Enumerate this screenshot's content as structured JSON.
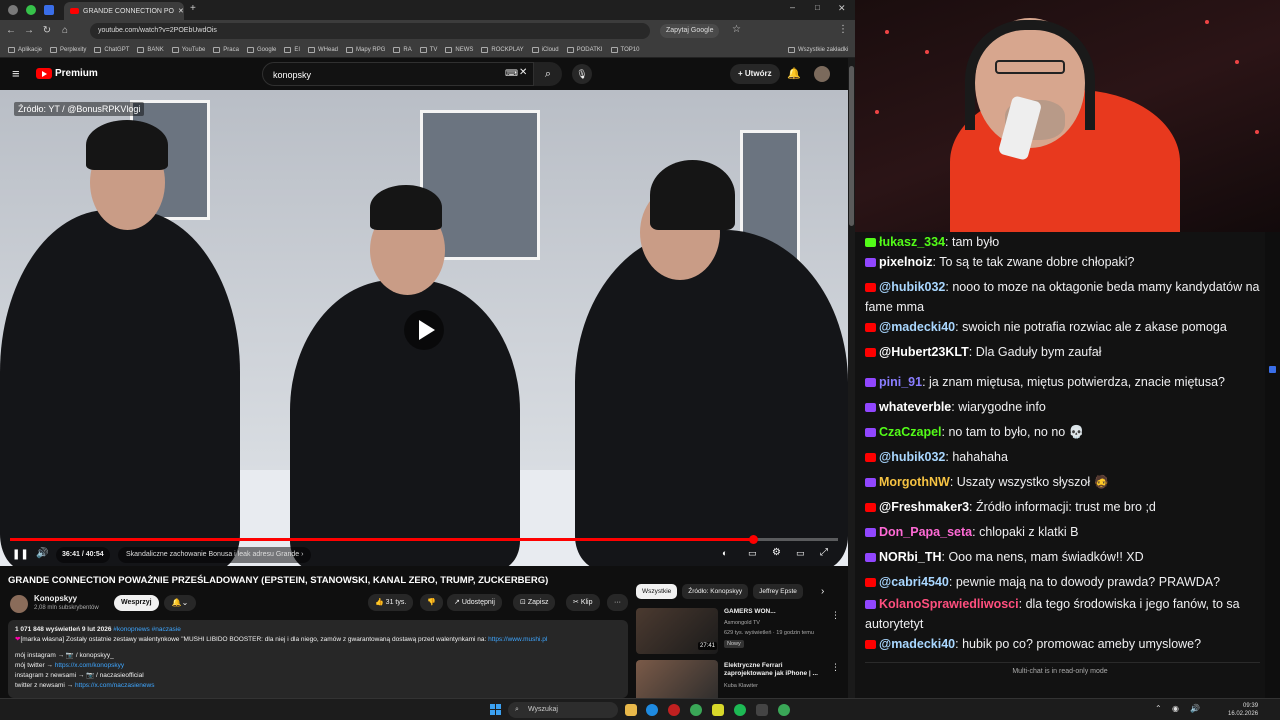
{
  "browser": {
    "tab_title": "GRANDE CONNECTION PO",
    "url": "youtube.com/watch?v=2POEbUwdOis",
    "ask_google": "Zapytaj Google",
    "bookmarks": [
      "Aplikacje",
      "Perplexity",
      "ChatGPT",
      "BANK",
      "YouTube",
      "Praca",
      "Google",
      "EI",
      "WHead",
      "Mapy RPG",
      "RA",
      "TV",
      "NEWS",
      "ROCKPLAY",
      "iCloud",
      "PODATKI",
      "TOP10"
    ],
    "all_bookmarks": "Wszystkie zakładki"
  },
  "yt": {
    "logo": "Premium",
    "search_value": "konopsky",
    "create": "Utwórz"
  },
  "video": {
    "source_overlay": "Źródło: YT / @BonusRPKVlogi",
    "time": "36:41 / 40:54",
    "chapter": "Skandaliczne zachowanie Bonusa i leak adresu Grande",
    "progress": 0.897,
    "title": "GRANDE CONNECTION POWAŻNIE PRZEŚLADOWANY (EPSTEIN, STANOWSKI, KANAL ZERO, TRUMP, ZUCKERBERG)",
    "channel": "Konopskyy",
    "subs": "2,08 mln subskrybentów",
    "support": "Wesprzyj",
    "likes": "31 tys.",
    "share": "Udostępnij",
    "save": "Zapisz",
    "clip": "Klip",
    "more": "···",
    "desc_stats": "1 071 848 wyświetleń  9 lut 2026",
    "desc_tags": "#konopnews #naczasie",
    "desc_line1": "[marka własna] Zostały ostatnie zestawy walentynkowe \"MUSHI LIBIDO BOOSTER: dla niej i dla niego, zamów z gwarantowaną dostawą przed walentynkami na: ",
    "desc_link1": "https://www.mushi.pl",
    "desc_line2": "mój instagram → 📷 / konopskyy_",
    "desc_line3a": "mój twitter → ",
    "desc_link3": "https://x.com/konopskyy",
    "desc_line4": "instagram z newsami → 📷 / naczasieofficial",
    "desc_line5a": "twitter z newsami → ",
    "desc_link5": "https://x.com/naczasienews"
  },
  "recs": {
    "chips": [
      "Wszystkie",
      "Źródło: Konopskyy",
      "Jeffrey Epste"
    ],
    "items": [
      {
        "title": "GAMERS WON...",
        "channel": "Asmongold TV",
        "meta": "629 tys. wyświetleń · 19 godzin temu",
        "badge": "Nowy",
        "duration": "27:41"
      },
      {
        "title": "Elektryczne Ferrari zaprojektowane jak iPhone | ...",
        "channel": "Kuba Klawiter",
        "meta": "",
        "badge": "",
        "duration": ""
      }
    ]
  },
  "chat": {
    "messages": [
      {
        "platform": "tk",
        "user": "łukasz_334",
        "color": "#53fc18",
        "text": "tam było"
      },
      {
        "platform": "tw",
        "user": "pixelnoiz",
        "color": "#ffffff",
        "text": "To są te tak zwane dobre chłopaki?"
      },
      {
        "platform": "yt",
        "user": "@hubik032",
        "color": "#a9d7ff",
        "text": "nooo to moze na oktagonie beda mamy kandydatów na fame mma"
      },
      {
        "platform": "yt",
        "user": "@madecki40",
        "color": "#a9d7ff",
        "text": "swoich nie potrafia rozwiac ale z akase pomoga"
      },
      {
        "platform": "yt",
        "user": "@Hubert23KLT",
        "color": "#ffffff",
        "text": "Dla Gaduły bym zaufał"
      },
      {
        "platform": "tw",
        "user": "pini_91",
        "color": "#8a7dff",
        "text": "ja znam miętusa, miętus potwierdza, znacie miętusa?"
      },
      {
        "platform": "tw",
        "user": "whateverble",
        "color": "#ffffff",
        "text": "wiarygodne info"
      },
      {
        "platform": "tw",
        "user": "CzaCzapel",
        "color": "#53fc18",
        "text": "no tam to było, no no 💀"
      },
      {
        "platform": "yt",
        "user": "@hubik032",
        "color": "#a9d7ff",
        "text": "hahahaha"
      },
      {
        "platform": "tw",
        "user": "MorgothNW",
        "color": "#f6c343",
        "text": "Uszaty wszystko słyszoł 🧔"
      },
      {
        "platform": "yt",
        "user": "@Freshmaker3",
        "color": "#ffffff",
        "text": "Źródło informacji: trust me bro ;d"
      },
      {
        "platform": "tw",
        "user": "Don_Papa_seta",
        "color": "#ff6ad5",
        "text": "chlopaki z klatki B"
      },
      {
        "platform": "tw",
        "user": "NORbi_TH",
        "color": "#ffffff",
        "text": "Ooo ma nens, mam świadków!! XD"
      },
      {
        "platform": "yt",
        "user": "@cabri4540",
        "color": "#a9d7ff",
        "text": "pewnie mają na to dowody prawda? PRAWDA?"
      },
      {
        "platform": "tw",
        "user": "KolanoSprawiedliwosci",
        "color": "#ff4f7e",
        "text": "dla tego środowiska i jego fanów, to sa autorytetyt"
      },
      {
        "platform": "yt",
        "user": "@madecki40",
        "color": "#a9d7ff",
        "text": "hubik po co? promowac ameby umyslowe?"
      }
    ],
    "readonly": "Multi-chat is in read-only mode"
  },
  "taskbar": {
    "search": "Wyszukaj",
    "time": "09:39",
    "date": "16.02.2026"
  }
}
